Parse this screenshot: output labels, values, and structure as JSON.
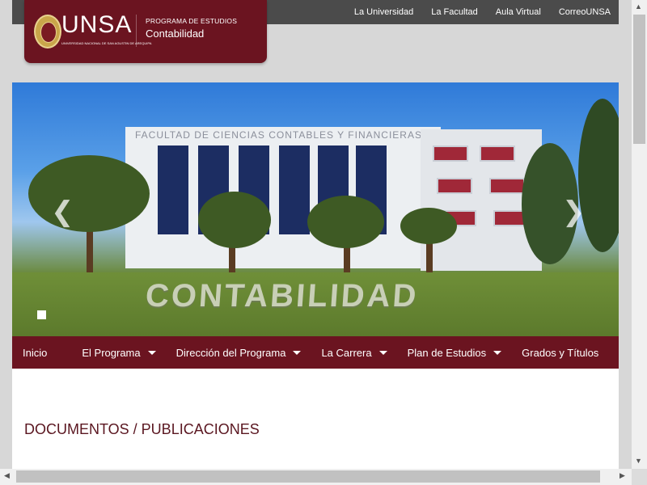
{
  "top_links": [
    "La Universidad",
    "La Facultad",
    "Aula Virtual",
    "CorreoUNSA"
  ],
  "logo": {
    "brand": "UNSA",
    "brand_subtitle": "UNIVERSIDAD NACIONAL DE SAN AGUSTIN DE AREQUIPA",
    "program_label": "PROGRAMA DE ESTUDIOS",
    "program_name": "Contabilidad"
  },
  "hero": {
    "facade_text": "FACULTAD DE CIENCIAS CONTABLES Y FINANCIERAS",
    "hedge_text": "CONTABILIDAD",
    "prev_icon": "chevron-left-icon",
    "next_icon": "chevron-right-icon"
  },
  "nav": {
    "items": [
      {
        "label": "Inicio",
        "dropdown": false
      },
      {
        "label": "El Programa",
        "dropdown": true
      },
      {
        "label": "Dirección del Programa",
        "dropdown": true
      },
      {
        "label": "La Carrera",
        "dropdown": true
      },
      {
        "label": "Plan de Estudios",
        "dropdown": true
      },
      {
        "label": "Grados y Títulos",
        "dropdown": false
      }
    ]
  },
  "main": {
    "section_title": "DOCUMENTOS / PUBLICACIONES"
  },
  "colors": {
    "brand": "#6b1420",
    "topbar": "#4b4b4b",
    "title_text": "#5a1620"
  }
}
